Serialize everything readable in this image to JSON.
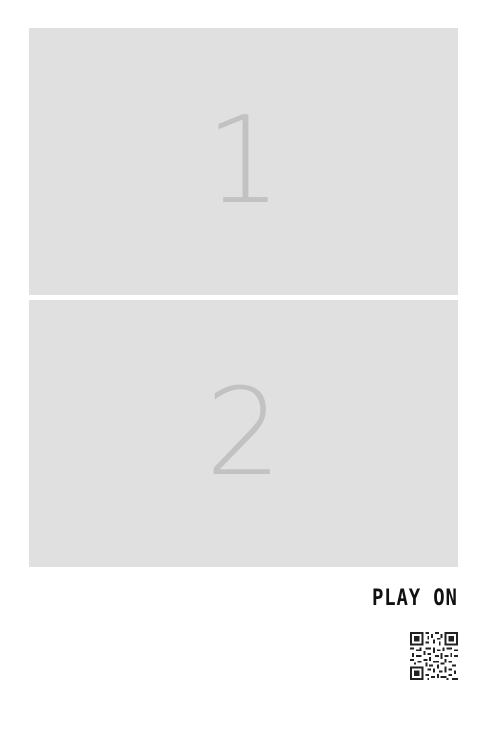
{
  "panels": [
    {
      "number": "1"
    },
    {
      "number": "2"
    }
  ],
  "footer": {
    "play_on_label": "PLAY ON"
  },
  "colors": {
    "panel_background": "#e0e0e0",
    "panel_number": "#c2c2c2",
    "label_text": "#111111",
    "qr_dark": "#222222"
  },
  "icons": {
    "qr": "qr-code-icon"
  }
}
